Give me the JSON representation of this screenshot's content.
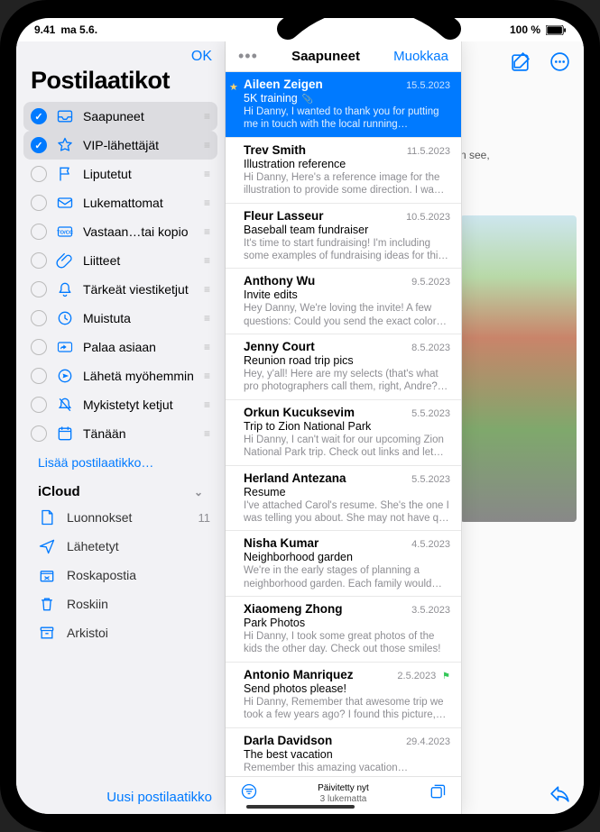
{
  "status": {
    "time": "9.41",
    "date": "ma 5.6.",
    "wifi": "wifi-icon",
    "battery_pct": "100 %",
    "battery_icon": "battery-icon"
  },
  "sidebar": {
    "ok_label": "OK",
    "title": "Postilaatikot",
    "items": [
      {
        "label": "Saapuneet",
        "icon": "inbox-icon",
        "checked": true,
        "selected": true
      },
      {
        "label": "VIP-lähettäjät",
        "icon": "star-icon",
        "checked": true,
        "selected": true
      },
      {
        "label": "Liputetut",
        "icon": "flag-icon",
        "checked": false
      },
      {
        "label": "Lukemattomat",
        "icon": "envelope-icon",
        "checked": false
      },
      {
        "label": "Vastaan…tai kopio",
        "icon": "tocc-icon",
        "checked": false
      },
      {
        "label": "Liitteet",
        "icon": "paperclip-icon",
        "checked": false
      },
      {
        "label": "Tärkeät viestiketjut",
        "icon": "bell-icon",
        "checked": false
      },
      {
        "label": "Muistuta",
        "icon": "clock-icon",
        "checked": false
      },
      {
        "label": "Palaa asiaan",
        "icon": "reply-later-icon",
        "checked": false
      },
      {
        "label": "Lähetä myöhemmin",
        "icon": "send-later-icon",
        "checked": false
      },
      {
        "label": "Mykistetyt ketjut",
        "icon": "mute-icon",
        "checked": false
      },
      {
        "label": "Tänään",
        "icon": "calendar-icon",
        "checked": false
      }
    ],
    "add_label": "Lisää postilaatikko…",
    "account_section": "iCloud",
    "account_items": [
      {
        "label": "Luonnokset",
        "icon": "draft-icon",
        "count": "11"
      },
      {
        "label": "Lähetetyt",
        "icon": "sent-icon"
      },
      {
        "label": "Roskapostia",
        "icon": "junk-icon"
      },
      {
        "label": "Roskiin",
        "icon": "trash-icon"
      },
      {
        "label": "Arkistoi",
        "icon": "archive-icon"
      }
    ],
    "new_mailbox": "Uusi postilaatikko"
  },
  "inbox": {
    "title": "Saapuneet",
    "edit_label": "Muokkaa",
    "messages": [
      {
        "sender": "Aileen Zeigen",
        "date": "15.5.2023",
        "subject": "5K training",
        "preview": "Hi Danny, I wanted to thank you for putting me in touch with the local running…",
        "unread": true,
        "star": true,
        "attach": true,
        "selected": true
      },
      {
        "sender": "Trev Smith",
        "date": "11.5.2023",
        "subject": "Illustration reference",
        "preview": "Hi Danny, Here's a reference image for the illustration to provide some direction. I wa…"
      },
      {
        "sender": "Fleur Lasseur",
        "date": "10.5.2023",
        "subject": "Baseball team fundraiser",
        "preview": "It's time to start fundraising! I'm including some examples of fundraising ideas for thi…"
      },
      {
        "sender": "Anthony Wu",
        "date": "9.5.2023",
        "subject": "Invite edits",
        "preview": "Hey Danny, We're loving the invite! A few questions: Could you send the exact color…"
      },
      {
        "sender": "Jenny Court",
        "date": "8.5.2023",
        "subject": "Reunion road trip pics",
        "preview": "Hey, y'all! Here are my selects (that's what pro photographers call them, right, Andre?…"
      },
      {
        "sender": "Orkun Kucuksevim",
        "date": "5.5.2023",
        "subject": "Trip to Zion National Park",
        "preview": "Hi Danny, I can't wait for our upcoming Zion National Park trip. Check out links and let…"
      },
      {
        "sender": "Herland Antezana",
        "date": "5.5.2023",
        "subject": "Resume",
        "preview": "I've attached Carol's resume. She's the one I was telling you about. She may not have q…"
      },
      {
        "sender": "Nisha Kumar",
        "date": "4.5.2023",
        "subject": "Neighborhood garden",
        "preview": "We're in the early stages of planning a neighborhood garden. Each family would…"
      },
      {
        "sender": "Xiaomeng Zhong",
        "date": "3.5.2023",
        "subject": "Park Photos",
        "preview": "Hi Danny, I took some great photos of the kids the other day. Check out those smiles!"
      },
      {
        "sender": "Antonio Manriquez",
        "date": "2.5.2023",
        "subject": "Send photos please!",
        "preview": "Hi Danny, Remember that awesome trip we took a few years ago? I found this picture,…",
        "flag": true
      },
      {
        "sender": "Darla Davidson",
        "date": "29.4.2023",
        "subject": "The best vacation",
        "preview": "Remember this amazing vacation…"
      }
    ],
    "footer": {
      "updated": "Päivitetty nyt",
      "unread": "3 lukematta"
    }
  },
  "message_pane": {
    "hint": "n see,"
  }
}
